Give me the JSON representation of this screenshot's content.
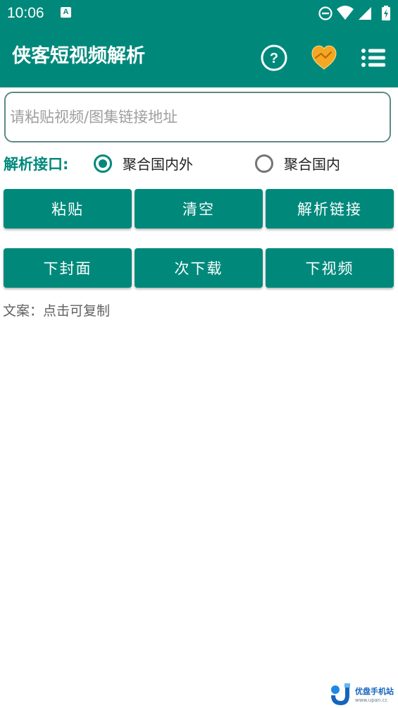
{
  "status_bar": {
    "time": "10:06",
    "notification_glyph": "A",
    "icons": [
      "dnd-icon",
      "wifi-icon",
      "signal-icon",
      "battery-charging-icon"
    ]
  },
  "toolbar": {
    "title": "侠客短视频解析",
    "icons": [
      "help-icon",
      "heart-icon",
      "menu-list-icon"
    ]
  },
  "url_input": {
    "value": "",
    "placeholder": "请粘贴视频/图集链接地址"
  },
  "api": {
    "label": "解析接口:",
    "options": [
      {
        "label": "聚合国内外",
        "selected": true
      },
      {
        "label": "聚合国内",
        "selected": false
      }
    ]
  },
  "buttons": {
    "row1": [
      "粘贴",
      "清空",
      "解析链接"
    ],
    "row2": [
      "下封面",
      "次下载",
      "下视频"
    ]
  },
  "caption": "文案：点击可复制",
  "watermark": {
    "name": "优盘手机站",
    "url": "www.upan.cc"
  },
  "colors": {
    "primary": "#00897b",
    "heart": "#f5a623"
  }
}
